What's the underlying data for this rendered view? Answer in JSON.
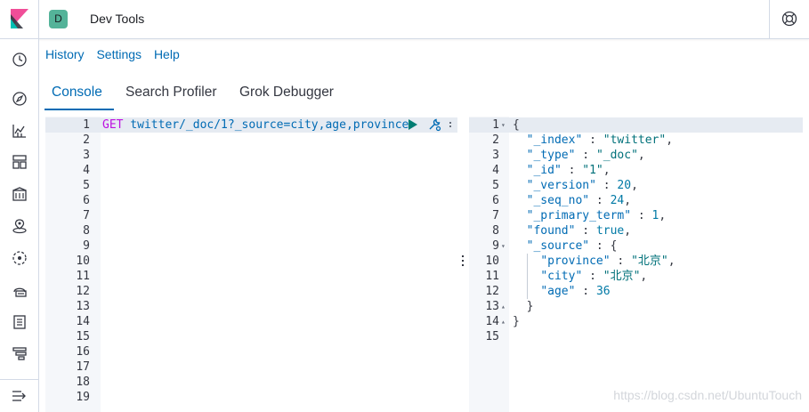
{
  "header": {
    "app_badge": "D",
    "title": "Dev Tools"
  },
  "toplinks": [
    "History",
    "Settings",
    "Help"
  ],
  "tabs": [
    "Console",
    "Search Profiler",
    "Grok Debugger"
  ],
  "request": {
    "lines": [
      {
        "n": "1",
        "method": "GET",
        "path": " twitter/_doc/1?_source=city,age,province"
      },
      {
        "n": "2"
      },
      {
        "n": "3"
      },
      {
        "n": "4"
      },
      {
        "n": "5"
      },
      {
        "n": "6"
      },
      {
        "n": "7"
      },
      {
        "n": "8"
      },
      {
        "n": "9"
      },
      {
        "n": "10"
      },
      {
        "n": "11"
      },
      {
        "n": "12"
      },
      {
        "n": "13"
      },
      {
        "n": "14"
      },
      {
        "n": "15"
      },
      {
        "n": "16"
      },
      {
        "n": "17"
      },
      {
        "n": "18"
      },
      {
        "n": "19"
      }
    ]
  },
  "response": {
    "lines": [
      {
        "n": "1",
        "fold": "▾",
        "text": "{"
      },
      {
        "n": "2",
        "text": "  \"_index\" : \"twitter\","
      },
      {
        "n": "3",
        "text": "  \"_type\" : \"_doc\","
      },
      {
        "n": "4",
        "text": "  \"_id\" : \"1\","
      },
      {
        "n": "5",
        "text": "  \"_version\" : 20,"
      },
      {
        "n": "6",
        "text": "  \"_seq_no\" : 24,"
      },
      {
        "n": "7",
        "text": "  \"_primary_term\" : 1,"
      },
      {
        "n": "8",
        "text": "  \"found\" : true,"
      },
      {
        "n": "9",
        "fold": "▾",
        "text": "  \"_source\" : {"
      },
      {
        "n": "10",
        "text": "    \"province\" : \"北京\","
      },
      {
        "n": "11",
        "text": "    \"city\" : \"北京\","
      },
      {
        "n": "12",
        "text": "    \"age\" : 36"
      },
      {
        "n": "13",
        "fold": "▴",
        "text": "  }"
      },
      {
        "n": "14",
        "fold": "▴",
        "text": "}"
      },
      {
        "n": "15",
        "text": ""
      }
    ]
  },
  "watermark": "https://blog.csdn.net/UbuntuTouch",
  "colors": {
    "accent": "#006bb4",
    "method": "#bd10e0",
    "string": "#00717a",
    "badge": "#54b399",
    "run": "#017d73"
  },
  "icons": {
    "nav": [
      "clock-icon",
      "compass-icon",
      "visualize-icon",
      "dashboard-icon",
      "canvas-icon",
      "maps-icon",
      "ml-icon",
      "infrastructure-icon",
      "logs-icon",
      "apm-icon"
    ],
    "request_actions": [
      "play-icon",
      "wrench-icon",
      "menu-dots-icon"
    ]
  }
}
